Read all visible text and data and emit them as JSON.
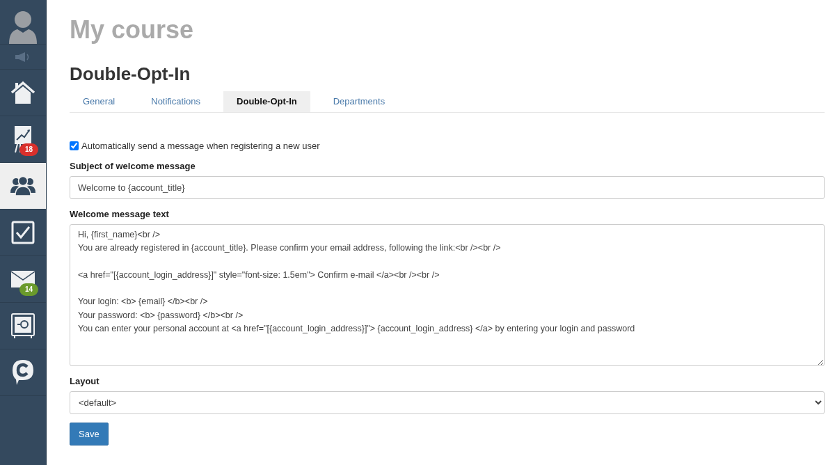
{
  "sidebar": {
    "items": [
      {
        "kind": "avatar",
        "selected": false
      },
      {
        "kind": "speaker",
        "selected": false
      },
      {
        "kind": "home",
        "selected": false
      },
      {
        "kind": "chart",
        "selected": false,
        "badge": {
          "text": "18",
          "color": "#d9302c"
        }
      },
      {
        "kind": "team",
        "selected": true
      },
      {
        "kind": "task",
        "selected": false
      },
      {
        "kind": "mail",
        "selected": false,
        "badge": {
          "text": "14",
          "color": "#6a9a2c"
        }
      },
      {
        "kind": "safe",
        "selected": false
      },
      {
        "kind": "chat",
        "selected": false
      }
    ]
  },
  "page_title": "My course",
  "section_title": "Double-Opt-In",
  "tabs": [
    {
      "label": "General",
      "selected": false
    },
    {
      "label": "Notifications",
      "selected": false
    },
    {
      "label": "Double-Opt-In",
      "selected": true
    },
    {
      "label": "Departments",
      "selected": false
    }
  ],
  "auto_send": {
    "label": "Automatically send a message when registering a new user",
    "checked": true
  },
  "subject": {
    "label": "Subject of welcome message",
    "value": "Welcome to {account_title}"
  },
  "message": {
    "label": "Welcome message text",
    "value": "Hi, {first_name}<br />\nYou are already registered in {account_title}. Please confirm your email address, following the link:<br /><br />\n\n<a href=\"[{account_login_address}]\" style=\"font-size: 1.5em\"> Confirm e-mail </a><br /><br />\n\nYour login: <b> {email} </b><br />\nYour password: <b> {password} </b><br />\nYou can enter your personal account at <a href=\"[{account_login_address}]\"> {account_login_address} </a> by entering your login and password"
  },
  "layout": {
    "label": "Layout",
    "value": "<default>"
  },
  "save_button": "Save"
}
